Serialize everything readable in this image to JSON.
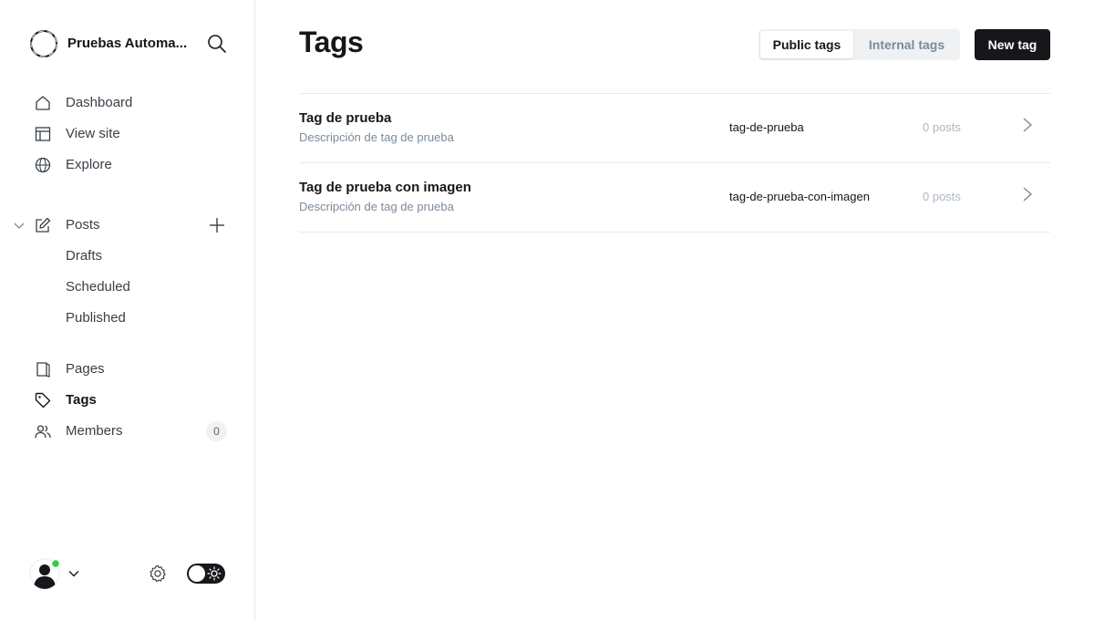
{
  "sidebar": {
    "site_name": "Pruebas Automa...",
    "nav": {
      "dashboard": "Dashboard",
      "view_site": "View site",
      "explore": "Explore",
      "posts": "Posts",
      "drafts": "Drafts",
      "scheduled": "Scheduled",
      "published": "Published",
      "pages": "Pages",
      "tags": "Tags",
      "members": "Members",
      "members_count": "0"
    },
    "active": "Tags",
    "icons": [
      "search-icon",
      "home-icon",
      "layout-icon",
      "globe-icon",
      "edit-icon",
      "plus-icon",
      "pages-icon",
      "tag-icon",
      "members-icon",
      "gear-icon",
      "sun-icon"
    ]
  },
  "header": {
    "title": "Tags",
    "filter_public": "Public tags",
    "filter_internal": "Internal tags",
    "new_tag": "New tag"
  },
  "tags": [
    {
      "name": "Tag de prueba",
      "description": "Descripción de tag de prueba",
      "slug": "tag-de-prueba",
      "count": "0 posts"
    },
    {
      "name": "Tag de prueba con imagen",
      "description": "Descripción de tag de prueba",
      "slug": "tag-de-prueba-con-imagen",
      "count": "0 posts"
    }
  ],
  "colors": {
    "accent": "#15171a",
    "online": "#30cf43",
    "muted": "#7c8b9a"
  }
}
